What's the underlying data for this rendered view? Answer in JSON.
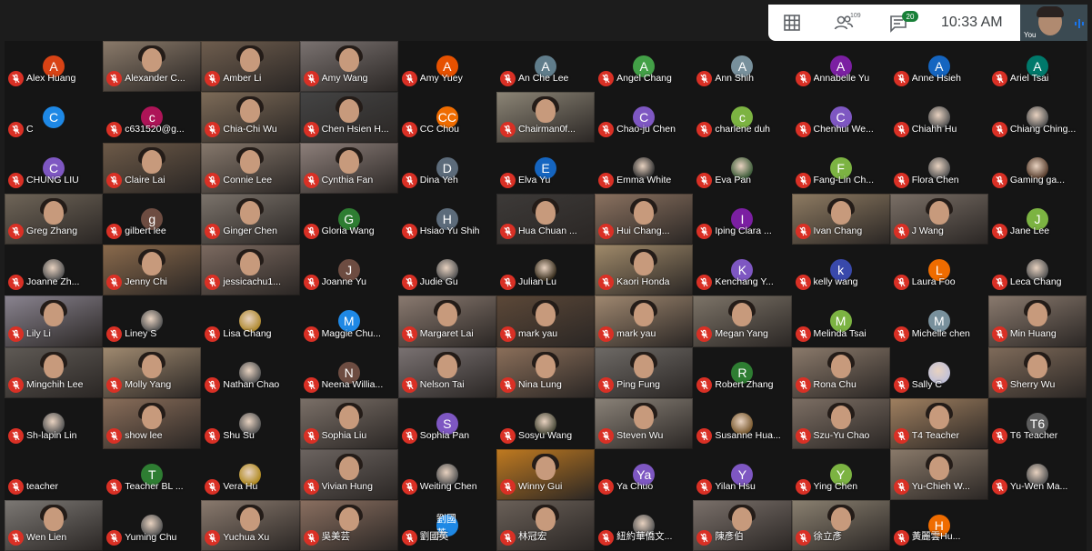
{
  "topbar": {
    "grid_icon": "grid-layout-icon",
    "people_icon": "people-icon",
    "people_count": "109",
    "chat_icon": "chat-icon",
    "chat_count": "20",
    "time": "10:33 AM",
    "self_label": "You"
  },
  "colors": {
    "background": "#1c1c1c",
    "mic_muted": "#d93025",
    "topbar": "#ffffff"
  },
  "participants": [
    {
      "name": "Alex Huang",
      "initial": "A",
      "bg": "#d84315"
    },
    {
      "name": "Alexander C...",
      "bg": "#8a7a6a",
      "video": true
    },
    {
      "name": "Amber Li",
      "bg": "#6e5d4e",
      "video": true
    },
    {
      "name": "Amy Wang",
      "bg": "#7a7270",
      "video": true
    },
    {
      "name": "Amy Yuey",
      "initial": "A",
      "bg": "#e65100"
    },
    {
      "name": "An Che Lee",
      "initial": "A",
      "bg": "#607d8b"
    },
    {
      "name": "Angel Chang",
      "initial": "A",
      "bg": "#43a047"
    },
    {
      "name": "Ann Shih",
      "initial": "A",
      "bg": "#78909c"
    },
    {
      "name": "Annabelle Yu",
      "initial": "A",
      "bg": "#7b1fa2"
    },
    {
      "name": "Anne Hsieh",
      "initial": "A",
      "bg": "#1565c0"
    },
    {
      "name": "Ariel Tsai",
      "initial": "A",
      "bg": "#00796b"
    },
    {
      "name": "C",
      "initial": "C",
      "bg": "#1e88e5"
    },
    {
      "name": "c631520@g...",
      "initial": "c",
      "bg": "#ad1457"
    },
    {
      "name": "Chia-Chi Wu",
      "bg": "#7d6b58",
      "video": true
    },
    {
      "name": "Chen Hsien H...",
      "bg": "#444444",
      "video": true
    },
    {
      "name": "CC Chou",
      "initial": "CC",
      "bg": "#ef6c00"
    },
    {
      "name": "Chairman0f...",
      "bg": "#8c8576",
      "video": true
    },
    {
      "name": "Chao-ju Chen",
      "initial": "C",
      "bg": "#7e57c2"
    },
    {
      "name": "charlene duh",
      "initial": "c",
      "bg": "#7cb342"
    },
    {
      "name": "Chenhui We...",
      "initial": "C",
      "bg": "#7e57c2"
    },
    {
      "name": "Chiahh Hu",
      "bg": "#555555",
      "video": false,
      "photo": true
    },
    {
      "name": "Chiang Ching...",
      "bg": "#555555",
      "photo": true
    },
    {
      "name": "CHUNG LIU",
      "initial": "C",
      "bg": "#7e57c2"
    },
    {
      "name": "Claire Lai",
      "bg": "#6d5a48",
      "video": true
    },
    {
      "name": "Connie Lee",
      "bg": "#86786c",
      "video": true
    },
    {
      "name": "Cynthia Fan",
      "bg": "#8d7f7a",
      "video": true
    },
    {
      "name": "Dina Yeh",
      "initial": "D",
      "bg": "#5c6b7a"
    },
    {
      "name": "Elva Yu",
      "initial": "E",
      "bg": "#1565c0"
    },
    {
      "name": "Emma White",
      "bg": "#333333",
      "photo": true
    },
    {
      "name": "Eva Pan",
      "bg": "#3e5d3a",
      "photo": true
    },
    {
      "name": "Fang-Lin Ch...",
      "initial": "F",
      "bg": "#7cb342"
    },
    {
      "name": "Flora Chen",
      "bg": "#555555",
      "photo": true
    },
    {
      "name": "Gaming ga...",
      "bg": "#5a4030",
      "photo": true
    },
    {
      "name": "Greg Zhang",
      "bg": "#6f6558",
      "video": true
    },
    {
      "name": "gilbert lee",
      "initial": "g",
      "bg": "#6d4c41"
    },
    {
      "name": "Ginger Chen",
      "bg": "#7b736b",
      "video": true
    },
    {
      "name": "Gloria Wang",
      "initial": "G",
      "bg": "#2e7d32"
    },
    {
      "name": "Hsiao Yu Shih",
      "initial": "H",
      "bg": "#5c6b7a"
    },
    {
      "name": "Hua Chuan ...",
      "bg": "#3d3a38",
      "video": true
    },
    {
      "name": "Hui Chang...",
      "bg": "#8b7260",
      "video": true
    },
    {
      "name": "Iping Clara ...",
      "initial": "I",
      "bg": "#7b1fa2"
    },
    {
      "name": "Ivan Chang",
      "bg": "#8e7b62",
      "video": true
    },
    {
      "name": "J Wang",
      "bg": "#7a6f66",
      "video": true
    },
    {
      "name": "Jane Lee",
      "initial": "J",
      "bg": "#7cb342"
    },
    {
      "name": "Joanne Zh...",
      "bg": "#555555",
      "photo": true
    },
    {
      "name": "Jenny Chi",
      "bg": "#8a6a4c",
      "video": true
    },
    {
      "name": "jessicachu1...",
      "bg": "#7c6a60",
      "video": true
    },
    {
      "name": "Joanne Yu",
      "initial": "J",
      "bg": "#6d4c41"
    },
    {
      "name": "Judie Gu",
      "bg": "#555555",
      "photo": true
    },
    {
      "name": "Julian Lu",
      "bg": "#3a3020",
      "photo": true
    },
    {
      "name": "Kaori Honda",
      "bg": "#a08a6a",
      "video": true
    },
    {
      "name": "Kenchang Y...",
      "initial": "K",
      "bg": "#7e57c2"
    },
    {
      "name": "kelly wang",
      "initial": "k",
      "bg": "#3949ab"
    },
    {
      "name": "Laura Foo",
      "initial": "L",
      "bg": "#ef6c00"
    },
    {
      "name": "Leca Chang",
      "bg": "#555555",
      "photo": true
    },
    {
      "name": "Lily Li",
      "bg": "#8a8490",
      "video": true
    },
    {
      "name": "Liney S",
      "bg": "#555555",
      "photo": true
    },
    {
      "name": "Lisa Chang",
      "bg": "#b08a30",
      "photo": true
    },
    {
      "name": "Maggie Chu...",
      "initial": "M",
      "bg": "#1e88e5"
    },
    {
      "name": "Margaret Lai",
      "bg": "#8a7a70",
      "video": true
    },
    {
      "name": "mark yau",
      "bg": "#5c4838",
      "video": true
    },
    {
      "name": "mark yau",
      "bg": "#a08870",
      "video": true
    },
    {
      "name": "Megan Yang",
      "bg": "#7d7468",
      "video": true
    },
    {
      "name": "Melinda Tsai",
      "initial": "M",
      "bg": "#7cb342"
    },
    {
      "name": "Michelle chen",
      "initial": "M",
      "bg": "#78909c"
    },
    {
      "name": "Min Huang",
      "bg": "#8a7a6e",
      "video": true
    },
    {
      "name": "Mingchih Lee",
      "bg": "#5f5a55",
      "video": true
    },
    {
      "name": "Molly Yang",
      "bg": "#a08a70",
      "video": true
    },
    {
      "name": "Nathan Chao",
      "bg": "#555555",
      "photo": true
    },
    {
      "name": "Neena Willia...",
      "initial": "N",
      "bg": "#6d4c41"
    },
    {
      "name": "Nelson Tai",
      "bg": "#7a7272",
      "video": true
    },
    {
      "name": "Nina Lung",
      "bg": "#8b6f5a",
      "video": true
    },
    {
      "name": "Ping Fung",
      "bg": "#6e6a66",
      "video": true
    },
    {
      "name": "Robert Zhang",
      "initial": "R",
      "bg": "#2e7d32"
    },
    {
      "name": "Rona Chu",
      "bg": "#8b7a6b",
      "video": true
    },
    {
      "name": "Sally C",
      "bg": "#c0c0d8",
      "photo": true
    },
    {
      "name": "Sherry Wu",
      "bg": "#7f6b5a",
      "video": true
    },
    {
      "name": "Sh-lapin Lin",
      "bg": "#555555",
      "photo": true
    },
    {
      "name": "show lee",
      "bg": "#8a6e5a",
      "video": true
    },
    {
      "name": "Shu Su",
      "bg": "#555555",
      "photo": true
    },
    {
      "name": "Sophia Liu",
      "bg": "#7b7068",
      "video": true
    },
    {
      "name": "Sophia Pan",
      "initial": "S",
      "bg": "#7e57c2"
    },
    {
      "name": "Sosyu Wang",
      "bg": "#4a4a3a",
      "photo": true
    },
    {
      "name": "Steven Wu",
      "bg": "#8a8278",
      "video": true
    },
    {
      "name": "Susanne Hua...",
      "bg": "#7a5a30",
      "photo": true
    },
    {
      "name": "Szu-Yu Chao",
      "bg": "#7d6f64",
      "video": true
    },
    {
      "name": "T4 Teacher",
      "bg": "#a08060",
      "video": true
    },
    {
      "name": "T6 Teacher",
      "initial": "T6",
      "bg": "#5c5c5c"
    },
    {
      "name": "teacher",
      "bg": "#151515",
      "blank": true
    },
    {
      "name": "Teacher BL ...",
      "initial": "T",
      "bg": "#2e7d32"
    },
    {
      "name": "Vera Hu",
      "bg": "#b08a20",
      "photo": true
    },
    {
      "name": "Vivian Hung",
      "bg": "#6c6460",
      "video": true
    },
    {
      "name": "Weiting Chen",
      "bg": "#555555",
      "photo": true
    },
    {
      "name": "Winny Gui",
      "bg": "#c07a20",
      "video": true
    },
    {
      "name": "Ya Chuo",
      "initial": "Ya",
      "bg": "#7e57c2"
    },
    {
      "name": "Yilan Hsu",
      "initial": "Y",
      "bg": "#7e57c2"
    },
    {
      "name": "Ying Chen",
      "initial": "Y",
      "bg": "#7cb342"
    },
    {
      "name": "Yu-Chieh W...",
      "bg": "#8a7a6a",
      "video": true
    },
    {
      "name": "Yu-Wen Ma...",
      "bg": "#555555",
      "photo": true
    },
    {
      "name": "Wen Lien",
      "bg": "#7c7874",
      "video": true
    },
    {
      "name": "Yuming Chu",
      "bg": "#555555",
      "photo": true
    },
    {
      "name": "Yuchua Xu",
      "bg": "#8a7a6e",
      "video": true
    },
    {
      "name": "吳美芸",
      "bg": "#8a6f60",
      "video": true
    },
    {
      "name": "劉國英",
      "initial": "劉國英",
      "bg": "#1e88e5",
      "small": true
    },
    {
      "name": "林冠宏",
      "bg": "#6a6058",
      "video": true
    },
    {
      "name": "紐約華僑文...",
      "bg": "#555555",
      "photo": true
    },
    {
      "name": "陳彥伯",
      "bg": "#7a706a",
      "video": true
    },
    {
      "name": "徐立彥",
      "bg": "#8a8070",
      "video": true
    },
    {
      "name": "黃麗雲Hu...",
      "initial": "H",
      "bg": "#ef6c00"
    },
    {
      "name": "",
      "bg": "#1c1c1c",
      "blank": true
    }
  ]
}
